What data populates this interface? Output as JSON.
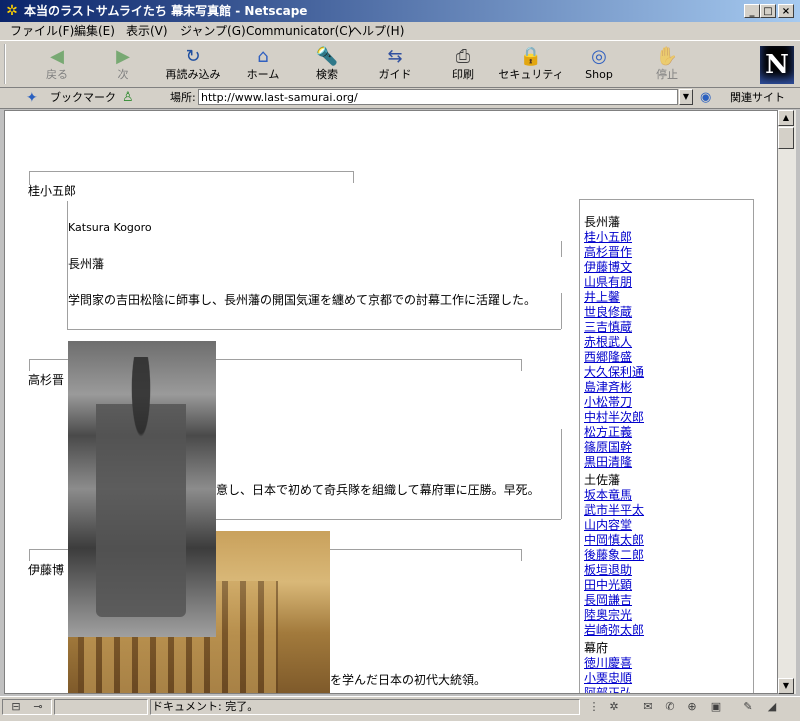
{
  "window": {
    "title": "本当のラストサムライたち 幕末写真館 - Netscape",
    "title_icon": "✲"
  },
  "window_controls": {
    "minimize": "_",
    "maximize": "□",
    "close": "×"
  },
  "menu": [
    "ファイル(F)",
    "編集(E)",
    "表示(V)",
    "ジャンプ(G)",
    "Communicator(C)",
    "ヘルプ(H)"
  ],
  "toolbar": {
    "buttons": [
      {
        "label": "戻る",
        "icon": "back-arrow-icon",
        "glyph": "◀",
        "color": "#2e8b2e",
        "disabled": true
      },
      {
        "label": "次",
        "icon": "forward-arrow-icon",
        "glyph": "▶",
        "color": "#2e8b2e",
        "disabled": true
      },
      {
        "label": "再読み込み",
        "icon": "reload-icon",
        "glyph": "↻",
        "color": "#1f4fa0",
        "disabled": false
      },
      {
        "label": "ホーム",
        "icon": "home-icon",
        "glyph": "⌂",
        "color": "#3060c0",
        "disabled": false
      },
      {
        "label": "検索",
        "icon": "search-icon",
        "glyph": "🔦",
        "color": "#c0a000",
        "disabled": false
      },
      {
        "label": "ガイド",
        "icon": "guide-icon",
        "glyph": "⇆",
        "color": "#3050a0",
        "disabled": false
      },
      {
        "label": "印刷",
        "icon": "print-icon",
        "glyph": "⎙",
        "color": "#404040",
        "disabled": false
      },
      {
        "label": "セキュリティ",
        "icon": "security-lock-icon",
        "glyph": "🔒",
        "color": "#b03030",
        "disabled": false
      },
      {
        "label": "Shop",
        "icon": "shop-bag-icon",
        "glyph": "◎",
        "color": "#3060c0",
        "disabled": false
      },
      {
        "label": "停止",
        "icon": "stop-icon",
        "glyph": "✋",
        "color": "#b03030",
        "disabled": true
      }
    ],
    "logo": "N"
  },
  "location_bar": {
    "bookmarks_label": "ブックマーク",
    "location_label": "場所:",
    "url": "http://www.last-samurai.org/",
    "related_label": "関連サイト"
  },
  "content": {
    "entries": [
      {
        "name": "桂小五郎",
        "romaji": "Katsura Kogoro",
        "clan": "長州藩",
        "desc": "学問家の吉田松陰に師事し、長州藩の開国気運を纏めて京都での討幕工作に活躍した。"
      },
      {
        "name": "高杉晋",
        "desc": "意し、日本で初めて奇兵隊を組織して幕府軍に圧勝。早死。"
      },
      {
        "name": "伊藤博",
        "desc": "を学んだ日本の初代大統領。"
      }
    ],
    "sidebar": {
      "groups": [
        {
          "head": "長州藩",
          "links": [
            "桂小五郎",
            "高杉晋作",
            "伊藤博文",
            "山県有朋",
            "井上馨",
            "世良修蔵",
            "三吉慎蔵",
            "赤根武人"
          ]
        },
        {
          "head": "",
          "links": [
            "西郷隆盛",
            "大久保利通",
            "島津斉彬",
            "小松帯刀",
            "中村半次郎",
            "松方正義",
            "篠原国幹",
            "黒田清隆"
          ]
        },
        {
          "head": "土佐藩",
          "links": [
            "坂本竜馬",
            "武市半平太",
            "山内容堂",
            "中岡慎太郎",
            "後藤象二郎",
            "板垣退助",
            "田中光顕",
            "長岡謙吉",
            "陸奥宗光",
            "岩崎弥太郎"
          ]
        },
        {
          "head": "幕府",
          "links": [
            "徳川慶喜",
            "小栗忠順",
            "阿部正弘"
          ]
        }
      ]
    }
  },
  "status": {
    "text": "ドキュメント: 完了。"
  }
}
